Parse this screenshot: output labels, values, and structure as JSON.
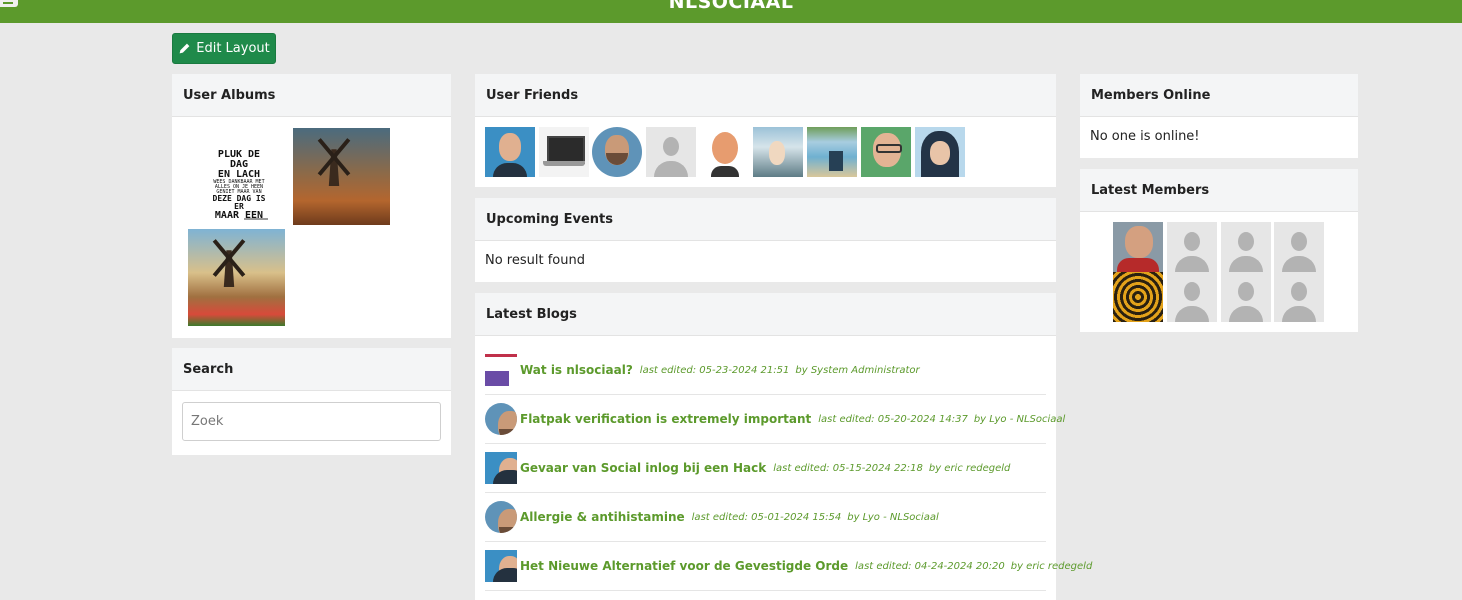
{
  "header": {
    "brand": "NLSOCIAAL"
  },
  "toolbar": {
    "edit_layout_label": "Edit Layout"
  },
  "user_albums": {
    "title": "User Albums",
    "album1_lines": [
      "PLUK DE DAG",
      "EN LACH",
      "WEES DANKBAAR MET",
      "ALLES ON JE HEEN",
      "GENIET MAAR VAN",
      "DEZE DAG IS ER",
      "MAAR EEN"
    ]
  },
  "search": {
    "title": "Search",
    "placeholder": "Zoek"
  },
  "user_friends": {
    "title": "User Friends"
  },
  "upcoming_events": {
    "title": "Upcoming Events",
    "empty": "No result found"
  },
  "latest_blogs": {
    "title": "Latest Blogs",
    "items": [
      {
        "title": "Wat is nlsociaal?",
        "edited": "last edited: 05-23-2024 21:51",
        "by": "by System Administrator"
      },
      {
        "title": "Flatpak verification is extremely important",
        "edited": "last edited: 05-20-2024 14:37",
        "by": "by Lyo - NLSociaal"
      },
      {
        "title": "Gevaar van Social inlog bij een Hack",
        "edited": "last edited: 05-15-2024 22:18",
        "by": "by eric redegeld"
      },
      {
        "title": "Allergie & antihistamine",
        "edited": "last edited: 05-01-2024 15:54",
        "by": "by Lyo - NLSociaal"
      },
      {
        "title": "Het Nieuwe Alternatief voor de Gevestigde Orde",
        "edited": "last edited: 04-24-2024 20:20",
        "by": "by eric redegeld"
      }
    ]
  },
  "members_online": {
    "title": "Members Online",
    "empty": "No one is online!"
  },
  "latest_members": {
    "title": "Latest Members"
  }
}
